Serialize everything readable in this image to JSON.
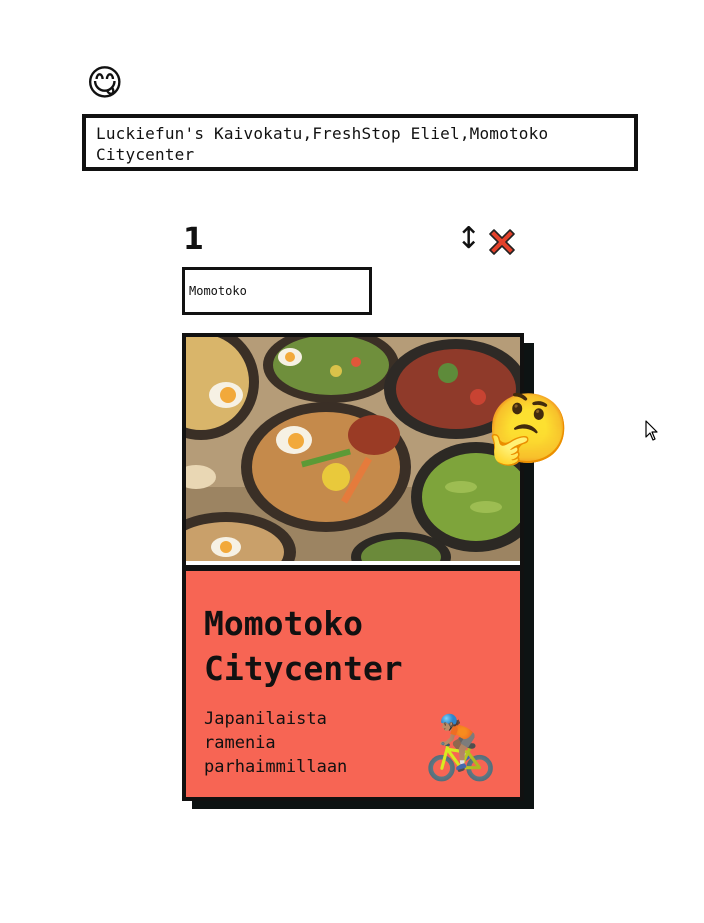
{
  "header": {
    "emoji": "😋",
    "favorites_text": "Luckiefun's Kaivokatu,FreshStop Eliel,Momotoko Citycenter"
  },
  "entry": {
    "position_number": "1",
    "reorder_icon": "↕",
    "remove_icon": "close-icon",
    "name_value": "Momotoko"
  },
  "card": {
    "reaction_emoji": "🤔",
    "title": "Momotoko Citycenter",
    "description": "Japanilaista ramenia parhaimmillaan",
    "delivery_emoji": "🚴🏽",
    "accent_color": "#f76554",
    "shadow_color": "#0d1313"
  }
}
